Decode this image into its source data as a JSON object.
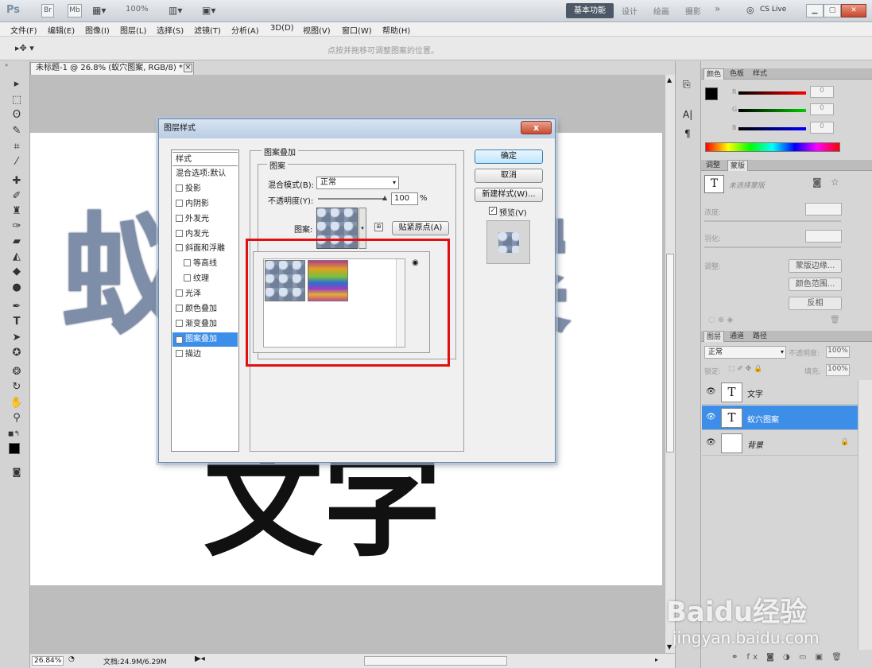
{
  "app": {
    "logo": "Ps",
    "small_buttons": [
      "Br",
      "Mb"
    ],
    "zoom_menu": "100%"
  },
  "workspace": {
    "active": "基本功能",
    "items": [
      "设计",
      "绘画",
      "摄影"
    ],
    "more": "»",
    "cs_live": "CS Live"
  },
  "menu": [
    "文件(F)",
    "编辑(E)",
    "图像(I)",
    "图层(L)",
    "选择(S)",
    "滤镜(T)",
    "分析(A)",
    "3D(D)",
    "视图(V)",
    "窗口(W)",
    "帮助(H)"
  ],
  "options_bar": {
    "hint": "点按并拖移可调整图案的位置。"
  },
  "document": {
    "tab_title": "未标题-1 @ 26.8% (蚁穴图案, RGB/8) *",
    "close": "×"
  },
  "canvas": {
    "text_top": "蚁穴图案",
    "text_bottom": "文字"
  },
  "status": {
    "zoom": "26.84%",
    "doc_info": "文档:24.9M/6.29M"
  },
  "color_panel": {
    "tabs": [
      "颜色",
      "色板",
      "样式"
    ],
    "channels": [
      {
        "label": "R",
        "value": "0"
      },
      {
        "label": "G",
        "value": "0"
      },
      {
        "label": "B",
        "value": "0"
      }
    ]
  },
  "adjust_panel": {
    "tabs": [
      "调整",
      "蒙版"
    ],
    "no_selection": "未选择蒙版",
    "density_label": "浓度:",
    "feather_label": "羽化:",
    "refine_label": "调整:",
    "buttons": [
      "蒙版边缘...",
      "颜色范围...",
      "反相"
    ]
  },
  "layers_panel": {
    "tabs": [
      "图层",
      "通道",
      "路径"
    ],
    "blend_mode": "正常",
    "opacity_label": "不透明度:",
    "opacity": "100%",
    "lock_label": "锁定:",
    "fill_label": "填充:",
    "fill": "100%",
    "layers": [
      {
        "name": "文字",
        "thumb": "T",
        "selected": false
      },
      {
        "name": "蚁穴图案",
        "thumb": "T",
        "selected": true
      },
      {
        "name": "背景",
        "thumb": "",
        "selected": false
      }
    ]
  },
  "dialog": {
    "title": "图层样式",
    "close": "x",
    "styles": [
      {
        "label": "样式",
        "checkbox": false,
        "checked": false,
        "sub": false,
        "selected": false
      },
      {
        "label": "混合选项:默认",
        "checkbox": false,
        "checked": false,
        "sub": false,
        "selected": false
      },
      {
        "label": "投影",
        "checkbox": true,
        "checked": false,
        "sub": false,
        "selected": false
      },
      {
        "label": "内阴影",
        "checkbox": true,
        "checked": false,
        "sub": false,
        "selected": false
      },
      {
        "label": "外发光",
        "checkbox": true,
        "checked": false,
        "sub": false,
        "selected": false
      },
      {
        "label": "内发光",
        "checkbox": true,
        "checked": false,
        "sub": false,
        "selected": false
      },
      {
        "label": "斜面和浮雕",
        "checkbox": true,
        "checked": false,
        "sub": false,
        "selected": false
      },
      {
        "label": "等高线",
        "checkbox": true,
        "checked": false,
        "sub": true,
        "selected": false
      },
      {
        "label": "纹理",
        "checkbox": true,
        "checked": false,
        "sub": true,
        "selected": false
      },
      {
        "label": "光泽",
        "checkbox": true,
        "checked": false,
        "sub": false,
        "selected": false
      },
      {
        "label": "颜色叠加",
        "checkbox": true,
        "checked": false,
        "sub": false,
        "selected": false
      },
      {
        "label": "渐变叠加",
        "checkbox": true,
        "checked": false,
        "sub": false,
        "selected": false
      },
      {
        "label": "图案叠加",
        "checkbox": true,
        "checked": true,
        "sub": false,
        "selected": true
      },
      {
        "label": "描边",
        "checkbox": true,
        "checked": false,
        "sub": false,
        "selected": false
      }
    ],
    "section_title": "图案叠加",
    "group_title": "图案",
    "blend_label": "混合模式(B):",
    "blend_value": "正常",
    "opacity_label": "不透明度(Y):",
    "opacity_value": "100",
    "opacity_unit": "%",
    "opacity_level": 1.0,
    "pattern_label": "图案:",
    "snap_button": "贴紧原点(A)",
    "ok": "确定",
    "cancel": "取消",
    "new_style": "新建样式(W)...",
    "preview_label": "预览(V)",
    "preview_checked": true
  },
  "watermark": {
    "brand": "Baidu经验",
    "url": "jingyan.baidu.com"
  },
  "colors": {
    "accent": "#3d8ee8",
    "highlight_box": "#e01010",
    "dialog_title": "#c7d8ec"
  }
}
